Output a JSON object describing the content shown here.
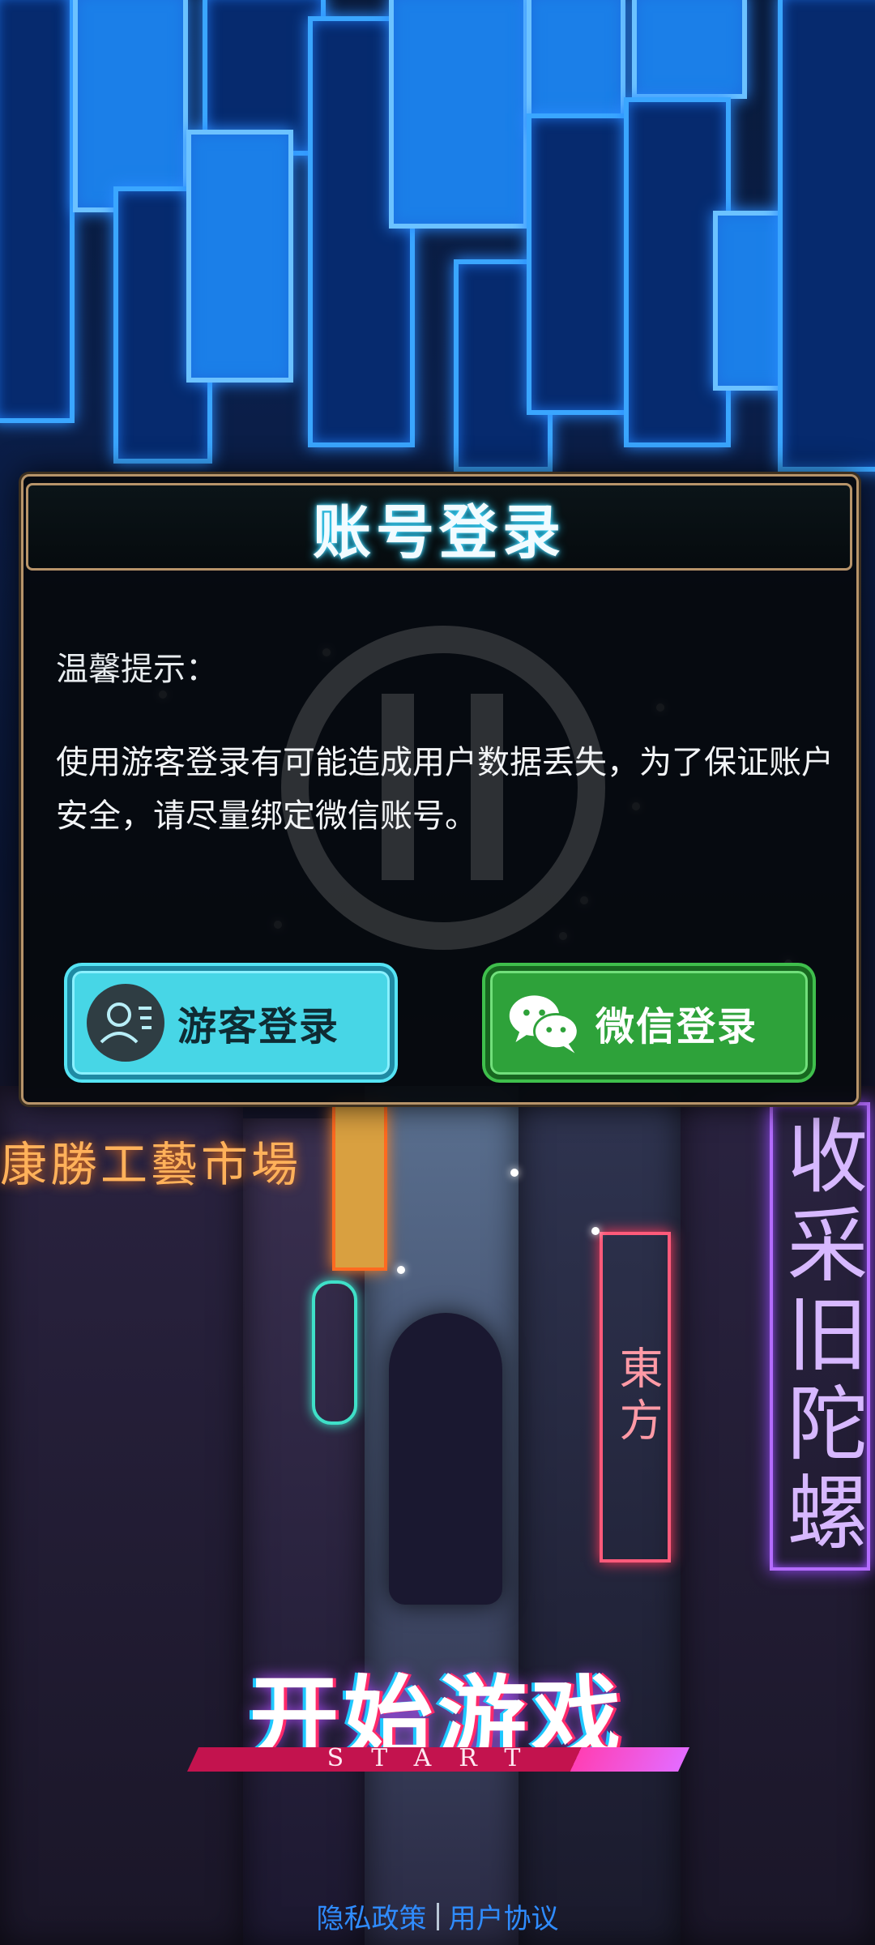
{
  "dialog": {
    "title": "账号登录",
    "tip_heading": "温馨提示：",
    "tip_body": "使用游客登录有可能造成用户数据丢失，为了保证账户安全，请尽量绑定微信账号。",
    "guest_button_label": "游客登录",
    "wechat_button_label": "微信登录"
  },
  "start": {
    "title": "开始游戏",
    "subtitle": "START"
  },
  "footer": {
    "privacy_label": "隐私政策",
    "agreement_label": "用户协议"
  },
  "background": {
    "left_sign": "康勝工藝市場",
    "right_sign": "收采旧陀螺",
    "small_sign": "東方"
  },
  "colors": {
    "accent_cyan": "#47d6e6",
    "accent_green": "#2ea23a",
    "dialog_border": "#b7946a",
    "link_blue": "#2f8cff"
  },
  "icons": {
    "guest": "user-card-icon",
    "wechat": "wechat-icon"
  }
}
